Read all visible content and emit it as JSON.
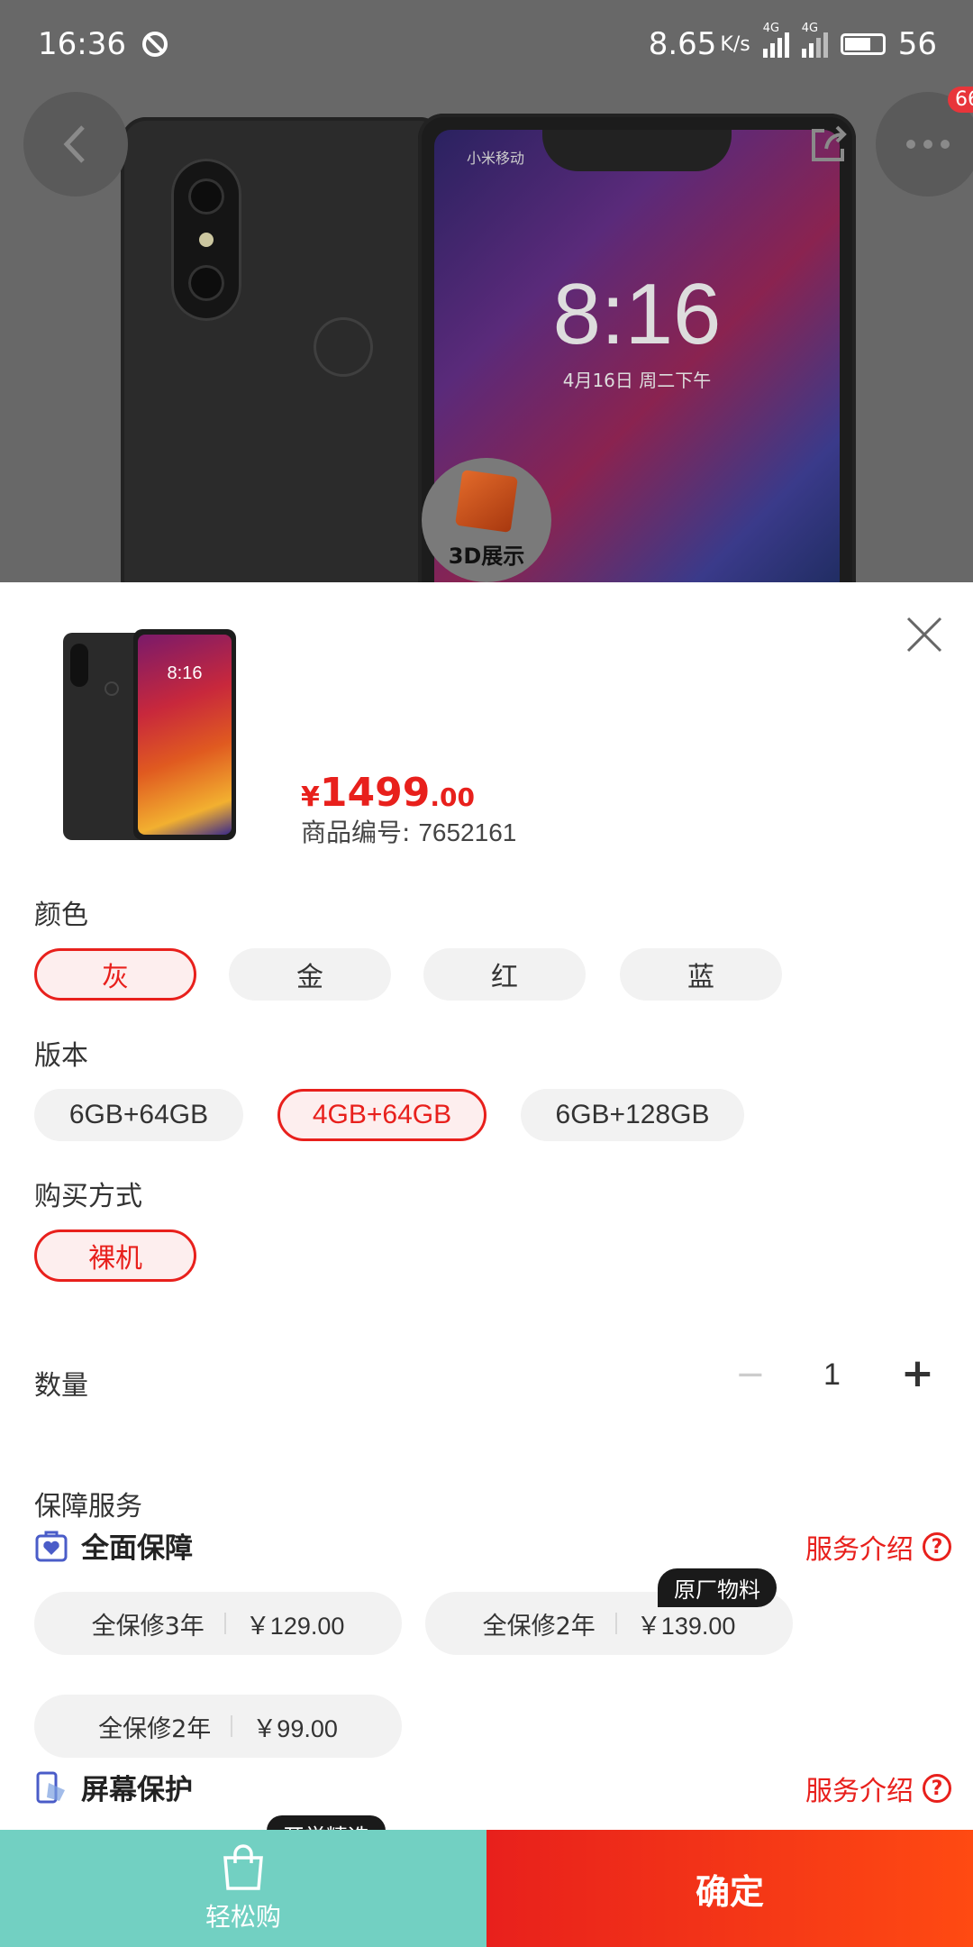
{
  "status_bar": {
    "time": "16:36",
    "net_speed": "8.65",
    "net_unit": "K/s",
    "battery": "56",
    "signal1": "4G",
    "signal2": "4G"
  },
  "header": {
    "badge_count": "66",
    "btn_3d_label": "3D展示"
  },
  "phone_mockup": {
    "carrier": "小米移动",
    "lock_time": "8:16",
    "lock_date": "4月16日 周二下午",
    "thumb_time": "8:16"
  },
  "product": {
    "price_symbol": "¥",
    "price_int": "1499",
    "price_dec": ".00",
    "sku_label": "商品编号:",
    "sku_value": "7652161"
  },
  "color_section": {
    "title": "颜色",
    "options": [
      "灰",
      "金",
      "红",
      "蓝"
    ],
    "selected": "灰"
  },
  "version_section": {
    "title": "版本",
    "options": [
      "6GB+64GB",
      "4GB+64GB",
      "6GB+128GB"
    ],
    "selected": "4GB+64GB"
  },
  "purchase_section": {
    "title": "购买方式",
    "options": [
      "裸机"
    ],
    "selected": "裸机"
  },
  "quantity": {
    "label": "数量",
    "value": "1",
    "minus": "−",
    "plus": "+"
  },
  "services": {
    "title": "保障服务",
    "full": {
      "title": "全面保障",
      "link": "服务介绍",
      "items": [
        {
          "name": "全保修3年",
          "price": "￥129.00",
          "tag": ""
        },
        {
          "name": "全保修2年",
          "price": "￥139.00",
          "tag": "原厂物料"
        },
        {
          "name": "全保修2年",
          "price": "￥99.00",
          "tag": ""
        }
      ]
    },
    "screen": {
      "title": "屏幕保护",
      "link": "服务介绍",
      "partial_tag": "开学精选"
    },
    "help_symbol": "?"
  },
  "bottom_bar": {
    "easy_buy": "轻松购",
    "confirm": "确定"
  },
  "colors": {
    "accent": "#e8201c",
    "teal": "#72d0c2",
    "chip_bg": "#f2f2f2"
  }
}
